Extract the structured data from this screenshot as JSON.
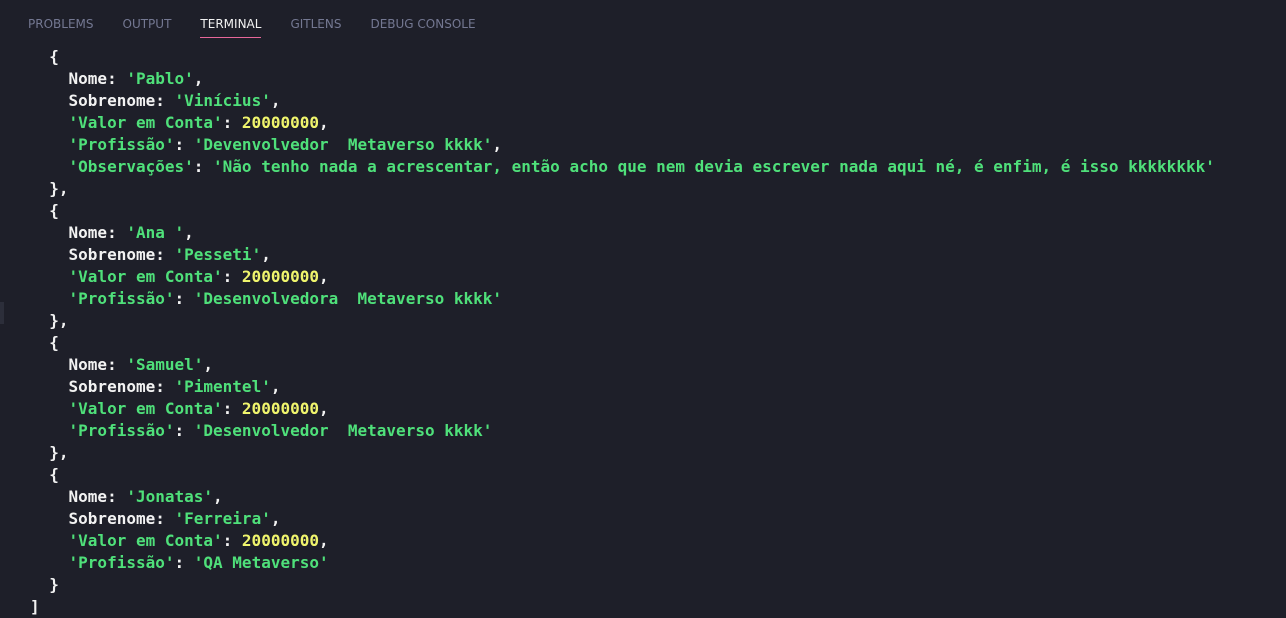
{
  "panel": {
    "tabs": [
      {
        "label": "PROBLEMS",
        "active": false
      },
      {
        "label": "OUTPUT",
        "active": false
      },
      {
        "label": "TERMINAL",
        "active": true
      },
      {
        "label": "GITLENS",
        "active": false
      },
      {
        "label": "DEBUG CONSOLE",
        "active": false
      }
    ]
  },
  "colors": {
    "background": "#1e1f29",
    "key": "#f2f2f2",
    "string": "#4fe07a",
    "number": "#f0f56d",
    "active_tab_underline": "#e8679a",
    "inactive_tab": "#747892"
  },
  "terminal": {
    "records": [
      {
        "fields": [
          {
            "key": "Nome",
            "quoted": false,
            "value": "'Pablo'",
            "type": "string"
          },
          {
            "key": "Sobrenome",
            "quoted": false,
            "value": "'Vinícius'",
            "type": "string"
          },
          {
            "key": "'Valor em Conta'",
            "quoted": true,
            "value": "20000000",
            "type": "number"
          },
          {
            "key": "'Profissão'",
            "quoted": true,
            "value": "'Devenvolvedor  Metaverso kkkk'",
            "type": "string"
          },
          {
            "key": "'Observações'",
            "quoted": true,
            "value": "'Não tenho nada a acrescentar, então acho que nem devia escrever nada aqui né, é enfim, é isso kkkkkkkk'",
            "type": "string"
          }
        ]
      },
      {
        "fields": [
          {
            "key": "Nome",
            "quoted": false,
            "value": "'Ana '",
            "type": "string"
          },
          {
            "key": "Sobrenome",
            "quoted": false,
            "value": "'Pesseti'",
            "type": "string"
          },
          {
            "key": "'Valor em Conta'",
            "quoted": true,
            "value": "20000000",
            "type": "number"
          },
          {
            "key": "'Profissão'",
            "quoted": true,
            "value": "'Desenvolvedora  Metaverso kkkk'",
            "type": "string"
          }
        ]
      },
      {
        "fields": [
          {
            "key": "Nome",
            "quoted": false,
            "value": "'Samuel'",
            "type": "string"
          },
          {
            "key": "Sobrenome",
            "quoted": false,
            "value": "'Pimentel'",
            "type": "string"
          },
          {
            "key": "'Valor em Conta'",
            "quoted": true,
            "value": "20000000",
            "type": "number"
          },
          {
            "key": "'Profissão'",
            "quoted": true,
            "value": "'Desenvolvedor  Metaverso kkkk'",
            "type": "string"
          }
        ]
      },
      {
        "fields": [
          {
            "key": "Nome",
            "quoted": false,
            "value": "'Jonatas'",
            "type": "string"
          },
          {
            "key": "Sobrenome",
            "quoted": false,
            "value": "'Ferreira'",
            "type": "string"
          },
          {
            "key": "'Valor em Conta'",
            "quoted": true,
            "value": "20000000",
            "type": "number"
          },
          {
            "key": "'Profissão'",
            "quoted": true,
            "value": "'QA Metaverso'",
            "type": "string"
          }
        ]
      }
    ]
  }
}
